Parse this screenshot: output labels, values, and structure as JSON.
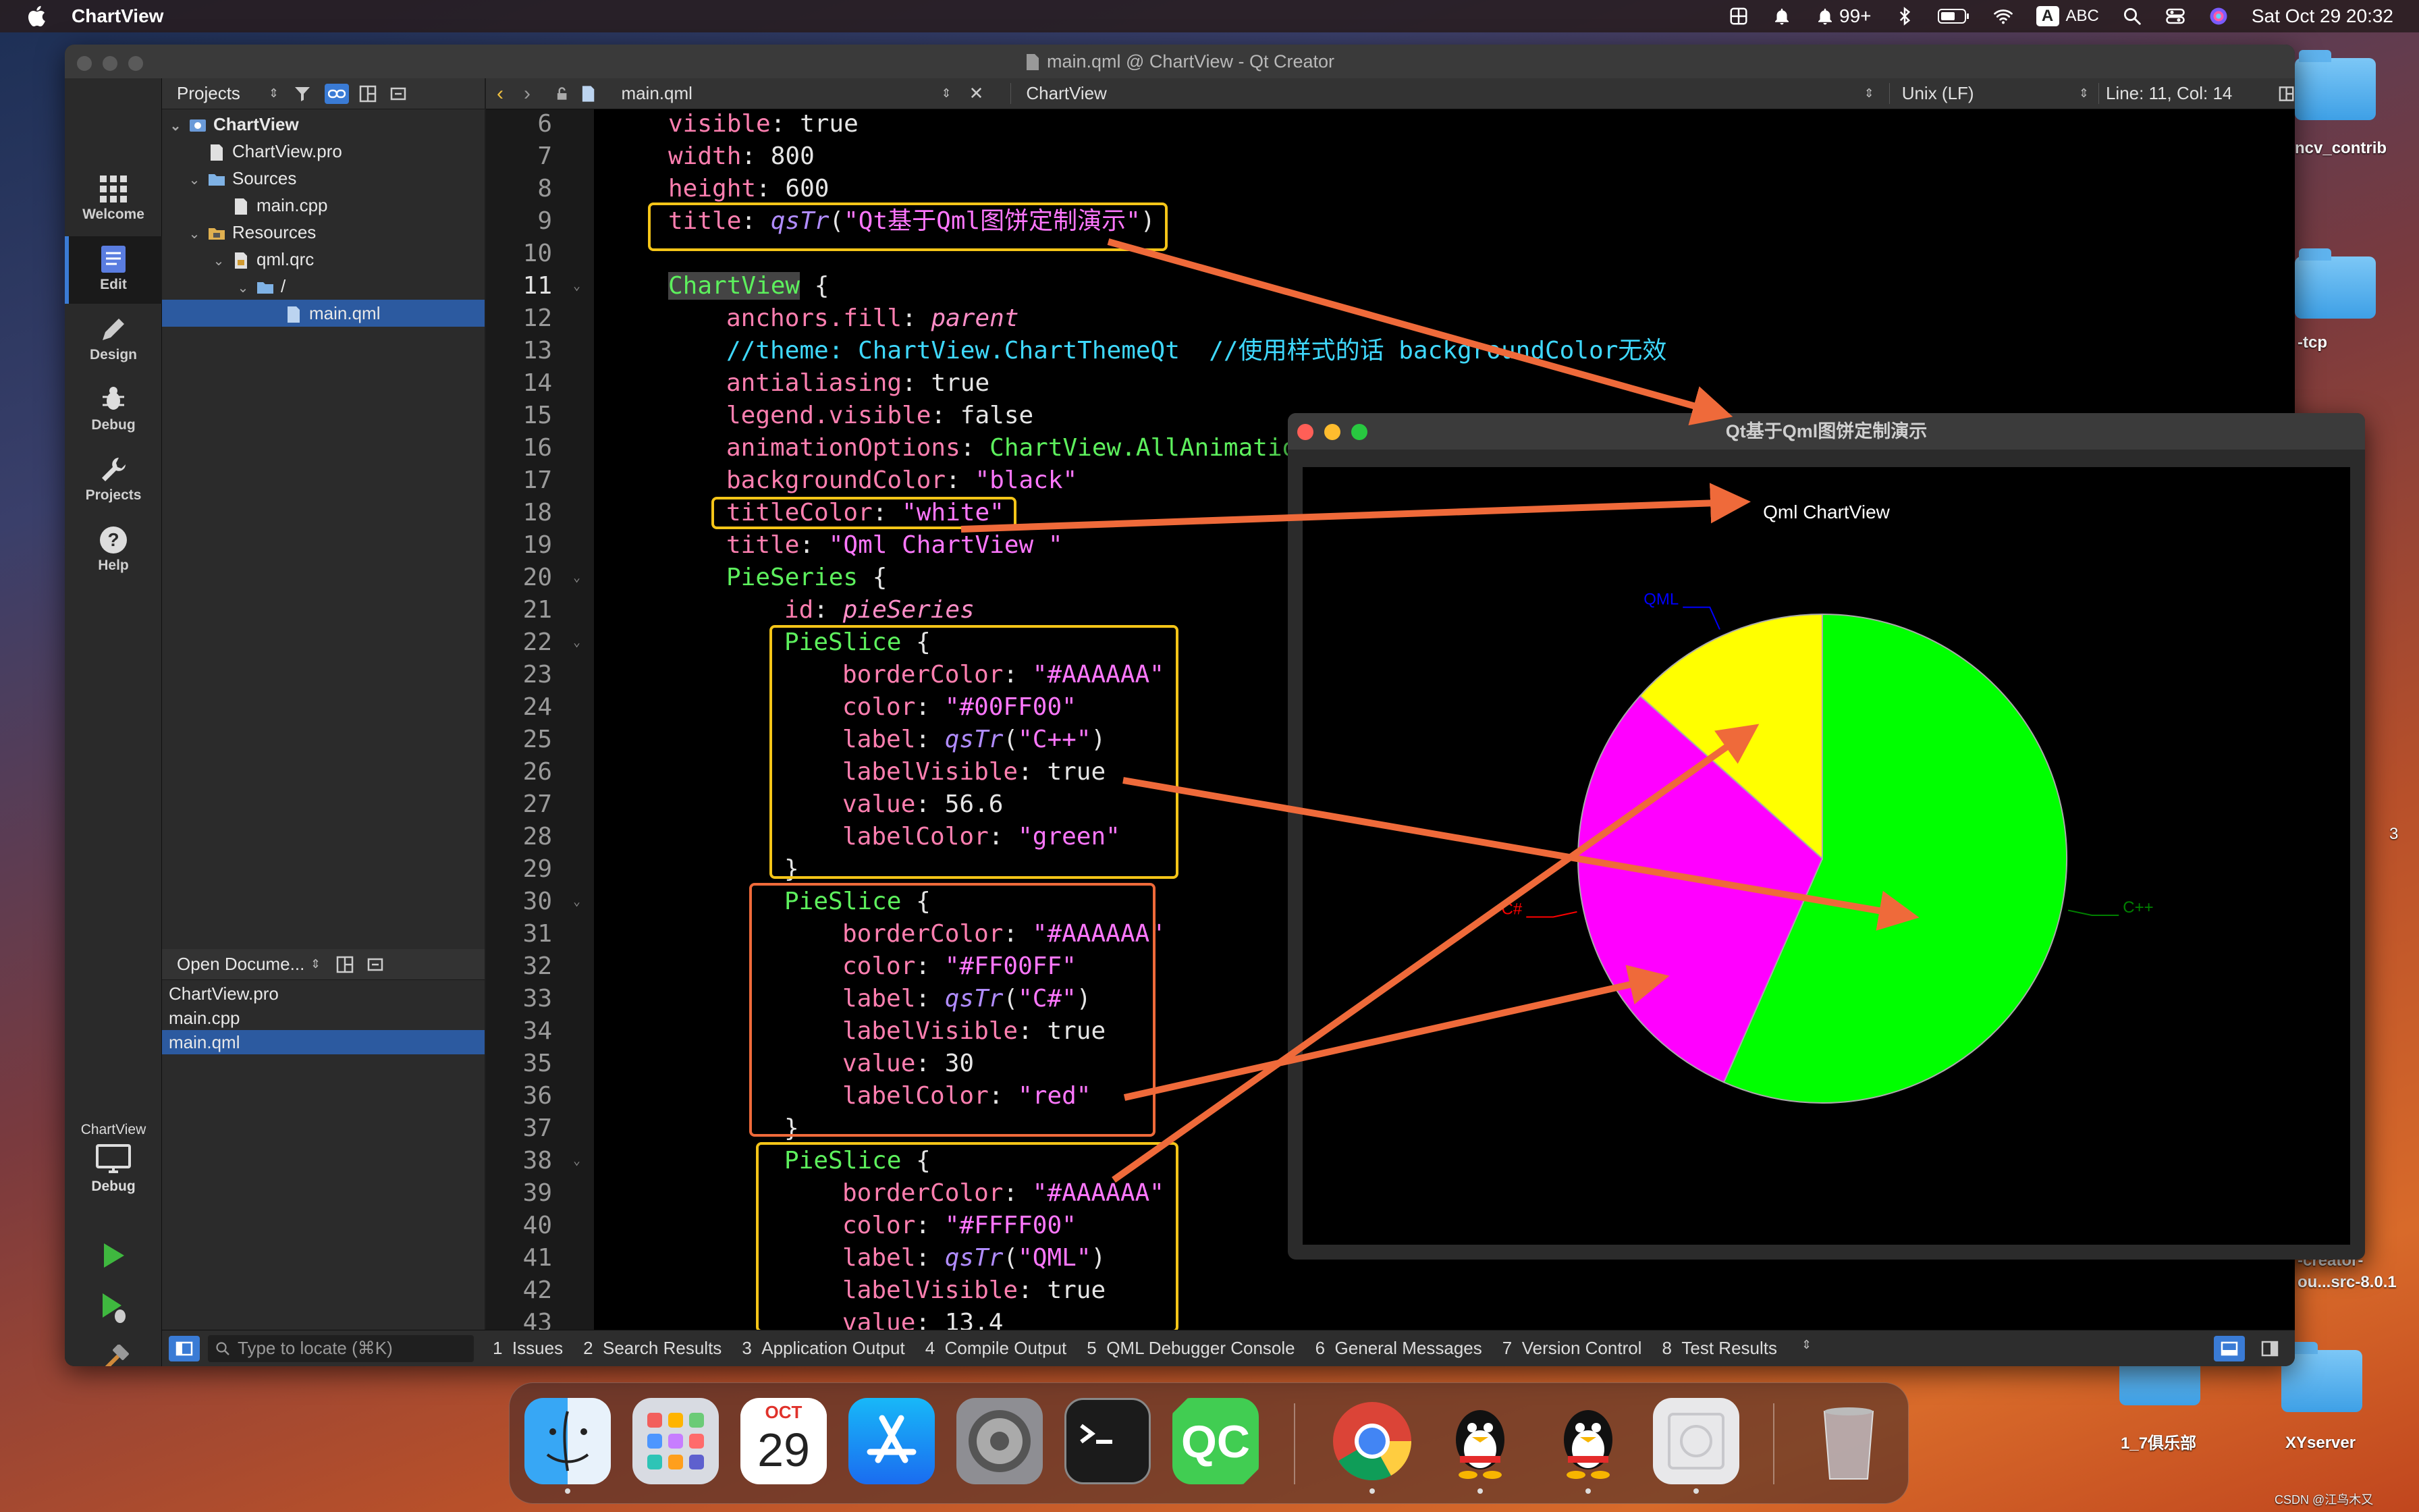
{
  "menubar": {
    "app_name": "ChartView",
    "notification_count": "99+",
    "input_method_badge": "A",
    "input_method": "ABC",
    "clock": "Sat Oct 29  20:32"
  },
  "desktop": {
    "icons": [
      {
        "label": "ncv_contrib"
      },
      {
        "label": "-tcp"
      },
      {
        "label": "1_7俱乐部"
      },
      {
        "label": "XYserver"
      }
    ],
    "partial_labels": [
      "-creator-",
      "ou...src-8.0.1",
      "3"
    ],
    "watermark": "CSDN @江鸟木又"
  },
  "qt_creator": {
    "window_title": "main.qml @ ChartView - Qt Creator",
    "modes": [
      {
        "label": "Welcome",
        "icon": "grid-icon"
      },
      {
        "label": "Edit",
        "icon": "document-icon"
      },
      {
        "label": "Design",
        "icon": "pencil-icon"
      },
      {
        "label": "Debug",
        "icon": "bug-icon"
      },
      {
        "label": "Projects",
        "icon": "wrench-icon"
      },
      {
        "label": "Help",
        "icon": "help-icon"
      }
    ],
    "kit": {
      "project": "ChartView",
      "config": "Debug"
    },
    "projects_pane": {
      "selector": "Projects",
      "tree": [
        {
          "label": "ChartView",
          "depth": 0,
          "expanded": true,
          "icon": "project-icon"
        },
        {
          "label": "ChartView.pro",
          "depth": 1,
          "icon": "pro-file-icon"
        },
        {
          "label": "Sources",
          "depth": 1,
          "expanded": true,
          "icon": "folder-icon"
        },
        {
          "label": "main.cpp",
          "depth": 2,
          "icon": "cpp-file-icon"
        },
        {
          "label": "Resources",
          "depth": 1,
          "expanded": true,
          "icon": "folder-icon"
        },
        {
          "label": "qml.qrc",
          "depth": 2,
          "expanded": true,
          "icon": "qrc-file-icon"
        },
        {
          "label": "/",
          "depth": 3,
          "expanded": true,
          "icon": "folder-icon"
        },
        {
          "label": "main.qml",
          "depth": 4,
          "selected": true,
          "icon": "qml-file-icon"
        }
      ]
    },
    "open_documents": {
      "header": "Open Docume...",
      "items": [
        {
          "label": "ChartView.pro"
        },
        {
          "label": "main.cpp"
        },
        {
          "label": "main.qml",
          "selected": true
        }
      ]
    },
    "editor": {
      "file_name": "main.qml",
      "symbol": "ChartView",
      "line_ending": "Unix (LF)",
      "cursor_position": "Line: 11, Col: 14",
      "line_numbers": [
        "6",
        "7",
        "8",
        "9",
        "10",
        "11",
        "12",
        "13",
        "14",
        "15",
        "16",
        "17",
        "18",
        "19",
        "20",
        "21",
        "22",
        "23",
        "24",
        "25",
        "26",
        "27",
        "28",
        "29",
        "30",
        "31",
        "32",
        "33",
        "34",
        "35",
        "36",
        "37",
        "38",
        "39",
        "40",
        "41",
        "42",
        "43"
      ]
    },
    "code": {
      "l6": [
        "visible",
        ": ",
        "true"
      ],
      "l7": [
        "width",
        ": ",
        "800"
      ],
      "l8": [
        "height",
        ": ",
        "600"
      ],
      "l9": [
        "title",
        ": ",
        "qsTr",
        "(",
        "\"Qt基于Qml图饼定制演示\"",
        ")"
      ],
      "l11": [
        "ChartView",
        " {"
      ],
      "l12": [
        "anchors.fill",
        ": ",
        "parent"
      ],
      "l13": "//theme: ChartView.ChartThemeQt  //使用样式的话 backgroundColor无效",
      "l14": [
        "antialiasing",
        ": ",
        "true"
      ],
      "l15": [
        "legend.visible",
        ": ",
        "false"
      ],
      "l16": [
        "animationOptions",
        ": ",
        "ChartView.AllAnimations"
      ],
      "l17": [
        "backgroundColor",
        ": ",
        "\"black\""
      ],
      "l18": [
        "titleColor",
        ": ",
        "\"white\""
      ],
      "l19": [
        "title",
        ": ",
        "\"Qml ChartView \""
      ],
      "l20": [
        "PieSeries",
        " {"
      ],
      "l21": [
        "id",
        ": ",
        "pieSeries"
      ],
      "slices": [
        {
          "open": "PieSlice",
          "brace": " {",
          "border_key": "borderColor",
          "border": "\"#AAAAAA\"",
          "color_key": "color",
          "color": "\"#00FF00\"",
          "label_key": "label",
          "label_fn": "qsTr",
          "label": "\"C++\"",
          "visible_key": "labelVisible",
          "visible": "true",
          "value_key": "value",
          "value": "56.6",
          "lc_key": "labelColor",
          "lc": "\"green\"",
          "close": "}"
        },
        {
          "open": "PieSlice",
          "brace": " {",
          "border_key": "borderColor",
          "border": "\"#AAAAAA\"",
          "color_key": "color",
          "color": "\"#FF00FF\"",
          "label_key": "label",
          "label_fn": "qsTr",
          "label": "\"C#\"",
          "visible_key": "labelVisible",
          "visible": "true",
          "value_key": "value",
          "value": "30",
          "lc_key": "labelColor",
          "lc": "\"red\"",
          "close": "}"
        },
        {
          "open": "PieSlice",
          "brace": " {",
          "border_key": "borderColor",
          "border": "\"#AAAAAA\"",
          "color_key": "color",
          "color": "\"#FFFF00\"",
          "label_key": "label",
          "label_fn": "qsTr",
          "label": "\"QML\"",
          "visible_key": "labelVisible",
          "visible": "true",
          "value_key": "value",
          "value": "13.4"
        }
      ],
      "colon": ": ",
      "open_paren": "(",
      "close_paren": ")"
    },
    "locator_placeholder": "Type to locate (⌘K)",
    "output_tabs": [
      {
        "num": "1",
        "label": "Issues"
      },
      {
        "num": "2",
        "label": "Search Results"
      },
      {
        "num": "3",
        "label": "Application Output"
      },
      {
        "num": "4",
        "label": "Compile Output"
      },
      {
        "num": "5",
        "label": "QML Debugger Console"
      },
      {
        "num": "6",
        "label": "General Messages"
      },
      {
        "num": "7",
        "label": "Version Control"
      },
      {
        "num": "8",
        "label": "Test Results"
      }
    ]
  },
  "chart_window": {
    "window_title": "Qt基于Qml图饼定制演示",
    "chart_data": {
      "type": "pie",
      "title": "Qml ChartView",
      "labels": [
        "C++",
        "C#",
        "QML"
      ],
      "values": [
        56.6,
        30,
        13.4
      ],
      "colors": [
        "#00FF00",
        "#FF00FF",
        "#FFFF00"
      ],
      "label_colors": [
        "#008000",
        "#FF0000",
        "#0000FF"
      ],
      "border_color": "#AAAAAA",
      "background": "#000000",
      "title_color": "#FFFFFF",
      "legend_visible": false
    }
  },
  "dock": {
    "calendar_month": "OCT",
    "calendar_day": "29",
    "apps": [
      "Finder",
      "Launchpad",
      "Calendar",
      "App Store",
      "System Preferences",
      "Terminal",
      "Qt Creator",
      "Chrome",
      "QQ",
      "QQ",
      "Preview",
      "Trash"
    ]
  },
  "colors": {
    "annotation_box": "#f5c518",
    "annotation_arrow": "#ef6a3a",
    "selection": "#2c5aa0"
  }
}
